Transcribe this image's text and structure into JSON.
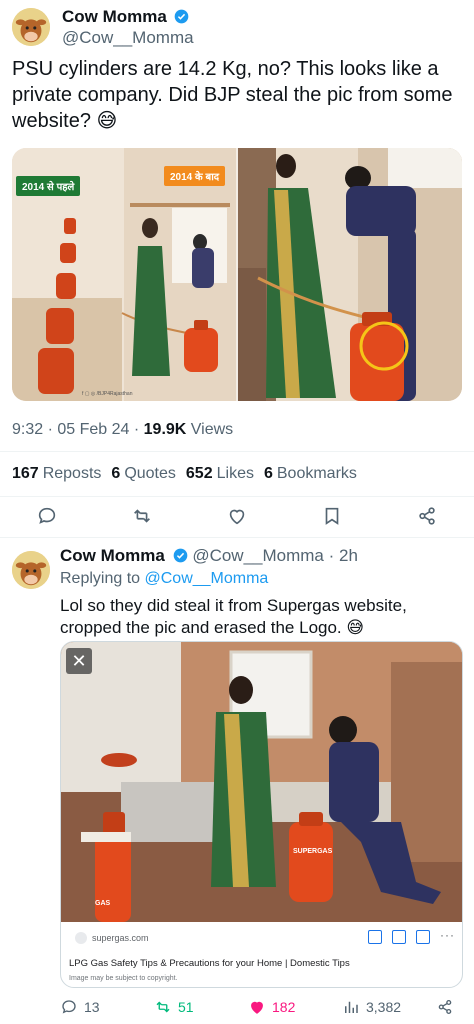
{
  "main_tweet": {
    "author_name": "Cow Momma",
    "author_handle": "@Cow__Momma",
    "text": "PSU cylinders are 14.2 Kg, no? This looks like a private company. Did BJP steal the pic from some website? 😅",
    "media": {
      "left_tag": "2014 से पहले",
      "right_tag": "2014 के बाद",
      "footer_text": "f ▢ ◎ /BJP4Rajasthan"
    },
    "time": "9:32 · 05 Feb 24 · ",
    "views_count": "19.9K",
    "views_label": " Views",
    "stats": {
      "reposts_count": "167",
      "reposts_label": "Reposts",
      "quotes_count": "6",
      "quotes_label": "Quotes",
      "likes_count": "652",
      "likes_label": "Likes",
      "bookmarks_count": "6",
      "bookmarks_label": "Bookmarks"
    }
  },
  "reply": {
    "author_name": "Cow Momma",
    "author_handle": "@Cow__Momma · 2h",
    "replying_prefix": "Replying to ",
    "replying_to": "@Cow__Momma",
    "text": "Lol so they did steal it from Supergas website, cropped the pic and erased the Logo. 😅",
    "card": {
      "close_symbol": "✕",
      "site": "supergas.com",
      "page_title": "LPG Gas Safety Tips & Precautions for your Home | Domestic Tips",
      "copyright": "Image may be subject to copyright.",
      "cylinder_brand": "SUPERGAS",
      "cylinder_brand_partial": "GAS"
    },
    "counts": {
      "replies": "13",
      "reposts": "51",
      "likes": "182",
      "views": "3,382"
    }
  },
  "colors": {
    "accent": "#1d9bf0",
    "like": "#f91880",
    "repost": "#00ba7c",
    "cylinder": "#e24a1d",
    "saree": "#2f6b3a"
  },
  "icons": [
    "reply-icon",
    "repost-icon",
    "like-icon",
    "bookmark-icon",
    "share-icon",
    "views-icon",
    "verified-icon",
    "close-icon"
  ]
}
